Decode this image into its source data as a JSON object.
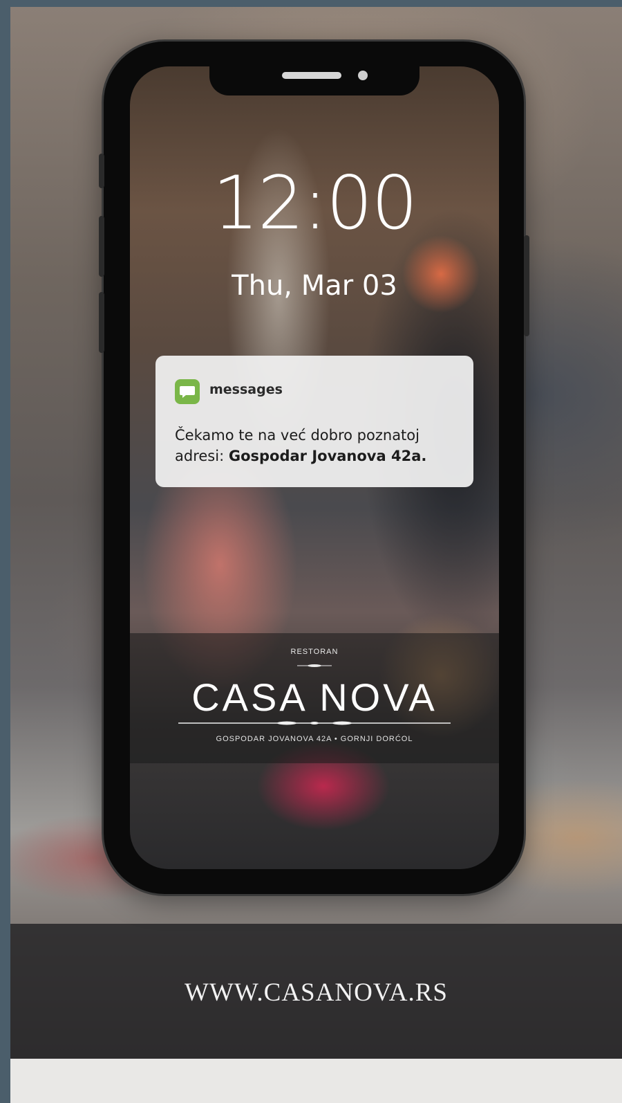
{
  "lockscreen": {
    "time": "12:00",
    "date": "Thu, Mar 03"
  },
  "notification": {
    "app_name": "messages",
    "icon": "message-bubble-icon",
    "body_text": "Čekamo te na već dobro poznatoj adresi: ",
    "body_bold": "Gospodar Jovanova 42a."
  },
  "logo": {
    "subtitle": "RESTORAN",
    "name": "CASA NOVA",
    "address": "GOSPODAR JOVANOVA 42A • GORNJI DORĆOL"
  },
  "footer": {
    "url": "WWW.CASANOVA.RS"
  },
  "colors": {
    "page_border": "#4b5e6b",
    "notification_icon": "#7ab648"
  }
}
